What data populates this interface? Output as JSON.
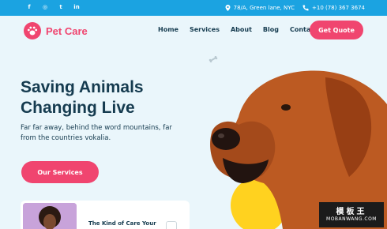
{
  "topbar": {
    "social": [
      "facebook-icon",
      "instagram-icon",
      "twitter-icon",
      "linkedin-icon"
    ],
    "social_glyphs": [
      "f",
      "◎",
      "t",
      "in"
    ],
    "address": "78/A, Green lane, NYC",
    "phone": "+10 (78) 367 3674"
  },
  "brand": {
    "name": "Pet Care",
    "color": "#f0456f"
  },
  "nav": {
    "items": [
      "Home",
      "Services",
      "About",
      "Blog",
      "Contact"
    ],
    "cta": "Get Quote"
  },
  "hero": {
    "title_line1": "Saving Animals",
    "title_line2": "Changing Live",
    "subtitle_line1": "Far far away, behind the word mountains, far",
    "subtitle_line2": "from the countries vokalia.",
    "cta": "Our Services"
  },
  "card": {
    "title": "The Kind of Care Your"
  },
  "watermark": {
    "cn": "模板王",
    "en": "MOBANWANG.COM"
  },
  "colors": {
    "accent": "#f0456f",
    "topbar": "#1ba3e1",
    "heading": "#153b4f",
    "background": "#eaf6fb",
    "yellow": "#ffd21f"
  }
}
